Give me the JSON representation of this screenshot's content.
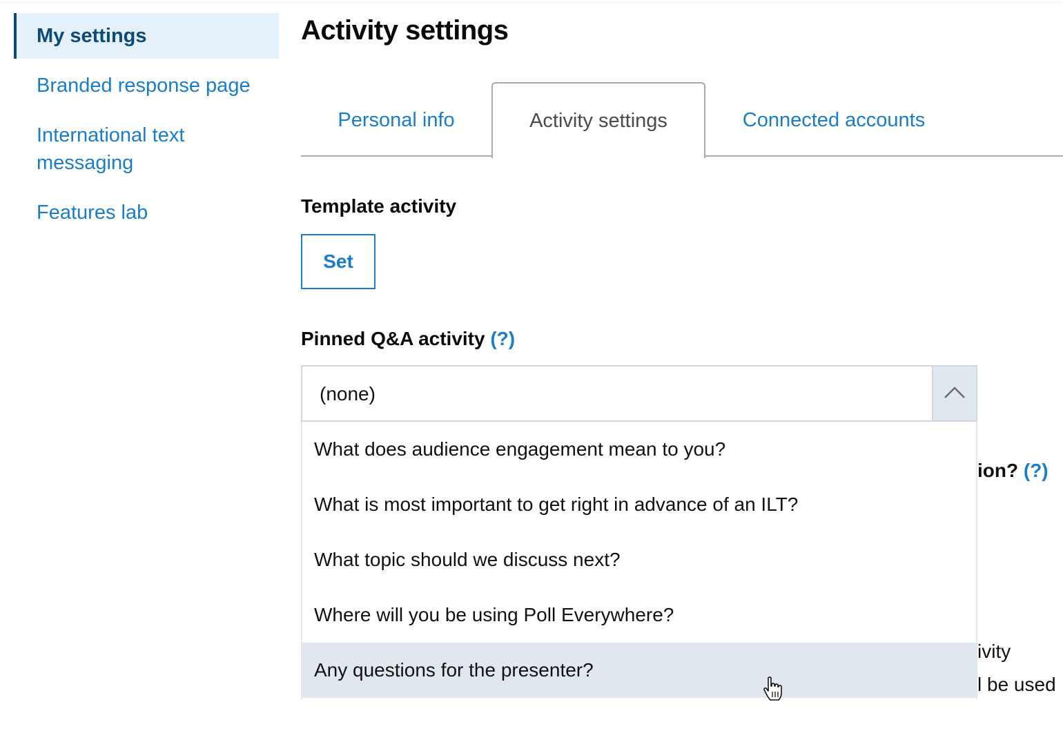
{
  "sidebar": {
    "items": [
      {
        "label": "My settings",
        "active": true
      },
      {
        "label": "Branded response page",
        "active": false
      },
      {
        "label": "International text messaging",
        "active": false
      },
      {
        "label": "Features lab",
        "active": false
      }
    ]
  },
  "main": {
    "title": "Activity settings",
    "tabs": [
      {
        "label": "Personal info",
        "active": false
      },
      {
        "label": "Activity settings",
        "active": true
      },
      {
        "label": "Connected accounts",
        "active": false
      }
    ],
    "template_activity": {
      "label": "Template activity",
      "button_label": "Set"
    },
    "pinned_qa": {
      "label": "Pinned Q&A activity",
      "help_label": "(?)",
      "selected_value": "(none)",
      "dropdown_open": true,
      "options": [
        "What does audience engagement mean to you?",
        "What is most important to get right in advance of an ILT?",
        "What topic should we discuss next?",
        "Where will you be using Poll Everywhere?",
        "Any questions for the presenter?"
      ],
      "hovered_option_index": 4
    },
    "obscured_content": {
      "line1_fragment": "ion?",
      "line1_help": "(?)",
      "line2_fragment": "ivity",
      "line3_fragment": "l be used"
    }
  },
  "colors": {
    "link": "#1a7dc9",
    "active_nav_text": "#0c4a7a",
    "active_nav_bg": "#e4f1fa",
    "hover_option_bg": "#e1e7ee"
  }
}
